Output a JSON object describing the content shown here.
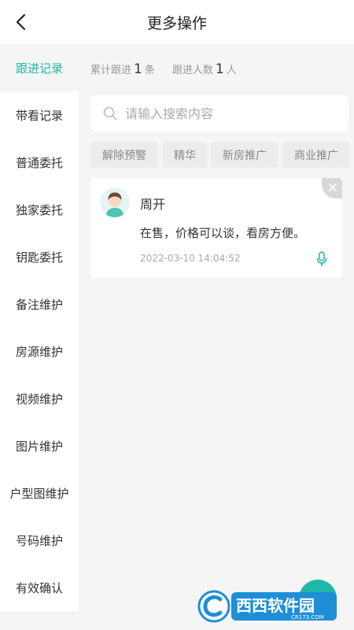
{
  "header": {
    "back_icon": "chevron-left-icon",
    "title": "更多操作"
  },
  "sidebar": {
    "items": [
      {
        "label": "跟进记录",
        "active": true
      },
      {
        "label": "带看记录",
        "active": false
      },
      {
        "label": "普通委托",
        "active": false
      },
      {
        "label": "独家委托",
        "active": false
      },
      {
        "label": "钥匙委托",
        "active": false
      },
      {
        "label": "备注维护",
        "active": false
      },
      {
        "label": "房源维护",
        "active": false
      },
      {
        "label": "视频维护",
        "active": false
      },
      {
        "label": "图片维护",
        "active": false
      },
      {
        "label": "户型图维护",
        "active": false
      },
      {
        "label": "号码维护",
        "active": false
      },
      {
        "label": "有效确认",
        "active": false
      }
    ]
  },
  "stats": {
    "total_label": "累计跟进",
    "total_value": "1",
    "total_unit": "条",
    "people_label": "跟进人数",
    "people_value": "1",
    "people_unit": "人"
  },
  "search": {
    "placeholder": "请输入搜索内容",
    "value": ""
  },
  "filters": [
    "解除预警",
    "精华",
    "新房推广",
    "商业推广"
  ],
  "record": {
    "name": "周开",
    "content": "在售，价格可以谈，看房方便。",
    "time": "2022-03-10 14:04:52"
  },
  "watermark": {
    "text": "西西软件园",
    "sub": "CR173.COM"
  },
  "colors": {
    "accent": "#1fb8a8",
    "background": "#f5f5f5"
  }
}
